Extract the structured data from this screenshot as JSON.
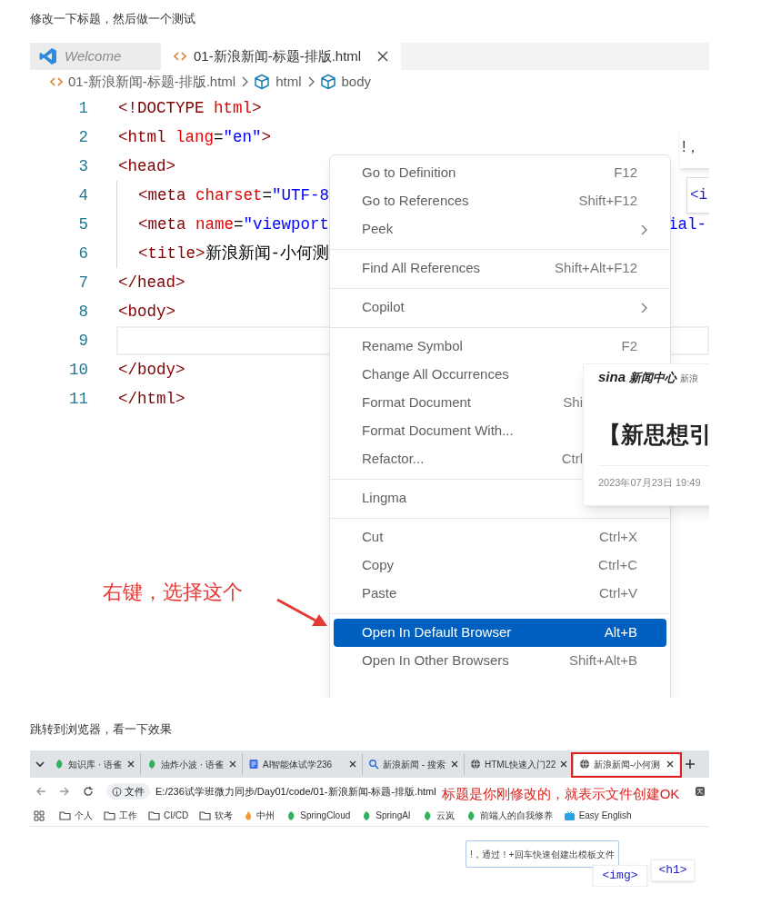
{
  "intro_text": "修改一下标题，然后做一个测试",
  "editor_screenshot": {
    "tabs": [
      {
        "label": "Welcome",
        "selected": false,
        "kind": "welcome"
      },
      {
        "label": "01-新浪新闻-标题-排版.html",
        "selected": true,
        "kind": "file"
      }
    ],
    "breadcrumb": [
      {
        "label": "01-新浪新闻-标题-排版.html",
        "kind": "file"
      },
      {
        "label": "html",
        "kind": "element"
      },
      {
        "label": "body",
        "kind": "element"
      }
    ],
    "code_lines": [
      {
        "number": "1",
        "current": false,
        "segments": [
          {
            "text": "<!DOCTYPE",
            "kind": "tag"
          },
          {
            "text": " html",
            "kind": "attr"
          },
          {
            "text": ">",
            "kind": "tag"
          }
        ]
      },
      {
        "number": "2",
        "current": false,
        "segments": [
          {
            "text": "<html",
            "kind": "tag"
          },
          {
            "text": " lang",
            "kind": "attr"
          },
          {
            "text": "=",
            "kind": "text"
          },
          {
            "text": "\"en\"",
            "kind": "string"
          },
          {
            "text": ">",
            "kind": "tag"
          }
        ]
      },
      {
        "number": "3",
        "current": false,
        "segments": [
          {
            "text": "<head>",
            "kind": "tag"
          }
        ],
        "children": [
          {
            "number": "4",
            "current": false,
            "segments": [
              {
                "text": "<meta",
                "kind": "tag"
              },
              {
                "text": " charset",
                "kind": "attr"
              },
              {
                "text": "=",
                "kind": "text"
              },
              {
                "text": "\"UTF-8",
                "kind": "string"
              }
            ]
          },
          {
            "number": "5",
            "current": false,
            "segments": [
              {
                "text": "<meta",
                "kind": "tag"
              },
              {
                "text": " name",
                "kind": "attr"
              },
              {
                "text": "=",
                "kind": "text"
              },
              {
                "text": "\"viewport",
                "kind": "string"
              }
            ],
            "tail": "ial-"
          },
          {
            "number": "6",
            "current": false,
            "segments": [
              {
                "text": "<title>",
                "kind": "tag"
              },
              {
                "text": "新浪新闻-小何测",
                "kind": "text"
              }
            ]
          }
        ]
      },
      {
        "number": "7",
        "current": false,
        "segments": [
          {
            "text": "</head>",
            "kind": "tag"
          }
        ]
      },
      {
        "number": "8",
        "current": false,
        "segments": [
          {
            "text": "<body>",
            "kind": "tag"
          }
        ]
      },
      {
        "number": "9",
        "current": true
      },
      {
        "number": "10",
        "current": false,
        "segments": [
          {
            "text": "</body>",
            "kind": "tag"
          }
        ]
      },
      {
        "number": "11",
        "current": false,
        "segments": [
          {
            "text": "</html>",
            "kind": "tag"
          }
        ]
      }
    ],
    "hint_fragment": "!，",
    "tag_fragment": "<i",
    "context_menu": [
      [
        {
          "label": "Go to Definition",
          "shortcut": "F12",
          "selected": false
        },
        {
          "label": "Go to References",
          "shortcut": "Shift+F12",
          "selected": false
        },
        {
          "label": "Peek",
          "submenu": true,
          "selected": false
        }
      ],
      [
        {
          "label": "Find All References",
          "shortcut": "Shift+Alt+F12",
          "selected": false
        }
      ],
      [
        {
          "label": "Copilot",
          "submenu": true,
          "selected": false
        }
      ],
      [
        {
          "label": "Rename Symbol",
          "shortcut": "F2",
          "selected": false
        },
        {
          "label": "Change All Occurrences",
          "selected": false
        },
        {
          "label": "Format Document",
          "shortcut": "Shi",
          "selected": false,
          "covered": true
        },
        {
          "label": "Format Document With...",
          "selected": false
        },
        {
          "label": "Refactor...",
          "shortcut": "Ctrl",
          "selected": false,
          "covered": true
        }
      ],
      [
        {
          "label": "Lingma",
          "selected": false
        }
      ],
      [
        {
          "label": "Cut",
          "shortcut": "Ctrl+X",
          "selected": false
        },
        {
          "label": "Copy",
          "shortcut": "Ctrl+C",
          "selected": false
        },
        {
          "label": "Paste",
          "shortcut": "Ctrl+V",
          "selected": false
        }
      ],
      [
        {
          "label": "Open In Default Browser",
          "shortcut": "Alt+B",
          "selected": true
        },
        {
          "label": "Open In Other Browsers",
          "shortcut": "Shift+Alt+B",
          "selected": false
        }
      ]
    ],
    "news_popup": {
      "logo": "sina",
      "section": "新闻中心",
      "site": "新浪",
      "headline": "【新思想引",
      "date": "2023年07月23日 19:49"
    },
    "annotation": "右键，选择这个"
  },
  "second_text": "跳转到浏览器，看一下效果",
  "browser_screenshot": {
    "tabs": [
      {
        "label": "知识库 · 语雀",
        "kind": "yuque",
        "selected": false
      },
      {
        "label": "油炸小波 · 语雀",
        "kind": "yuque",
        "selected": false
      },
      {
        "label": "AI智能体试学236",
        "kind": "doc",
        "selected": false
      },
      {
        "label": "新浪新闻 - 搜索",
        "kind": "search",
        "selected": false
      },
      {
        "label": "HTML快速入门22",
        "kind": "globe",
        "selected": false
      },
      {
        "label": "新浪新闻-小何测",
        "kind": "globe",
        "selected": true
      }
    ],
    "address": {
      "chip": "文件",
      "url": "E:/236试学班微力同步/Day01/code/01-新浪新闻-标题-排版.html"
    },
    "annotation": "标题是你刚修改的，就表示文件创建OK",
    "bookmarks": [
      {
        "label": "个人",
        "kind": "folder"
      },
      {
        "label": "工作",
        "kind": "folder"
      },
      {
        "label": "CI/CD",
        "kind": "folder"
      },
      {
        "label": "软考",
        "kind": "folder"
      },
      {
        "label": "中州",
        "kind": "flame"
      },
      {
        "label": "SpringCloud",
        "kind": "yuque"
      },
      {
        "label": "SpringAI",
        "kind": "yuque"
      },
      {
        "label": "云岚",
        "kind": "yuque"
      },
      {
        "label": "前端人的自我修养",
        "kind": "yuque"
      },
      {
        "label": "Easy English",
        "kind": "tv"
      }
    ],
    "hint": "!，通过！+回车快速创建出模板文件",
    "tags": [
      "<img>",
      "<h1>"
    ]
  }
}
